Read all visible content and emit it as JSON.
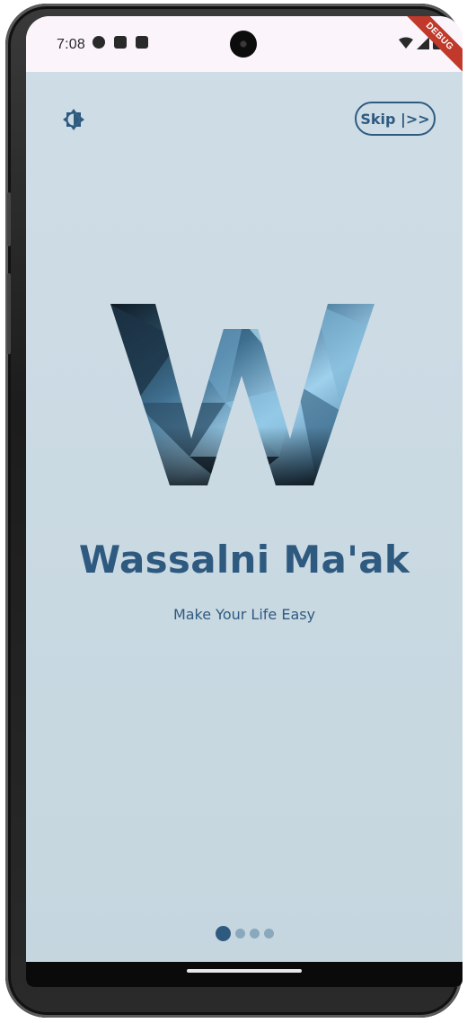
{
  "status_bar": {
    "time": "7:08",
    "left_icons": [
      "shield-icon",
      "a-icon",
      "sd-card-icon"
    ],
    "right_icons": [
      "wifi-icon",
      "signal-icon",
      "battery-icon"
    ],
    "debug_banner": "DEBUG"
  },
  "header": {
    "theme_toggle_icon": "brightness-icon",
    "skip_label": "Skip |>>"
  },
  "main": {
    "logo_letter": "W",
    "title": "Wassalni Ma'ak",
    "subtitle": "Make Your Life Easy"
  },
  "pager": {
    "total_pages": 4,
    "current_page": 1
  },
  "colors": {
    "accent": "#2f5a80",
    "background": "#cbdbe4",
    "status_bar": "#fbf4fb",
    "dot_inactive": "#8aa8bd",
    "debug_ribbon": "#c0392b"
  }
}
